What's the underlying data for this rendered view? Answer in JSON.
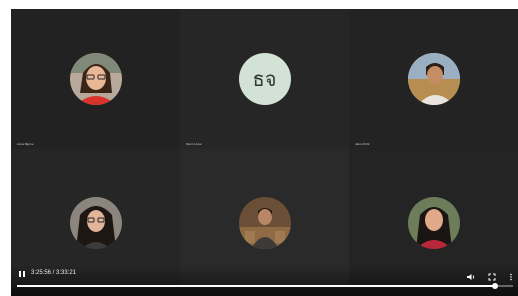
{
  "participants": [
    {
      "label": "Anna Bjorne"
    },
    {
      "label": "Simin Lhow",
      "initials": "ธจ"
    },
    {
      "label": "Jaron Pohl"
    },
    {
      "label": ""
    },
    {
      "label": ""
    },
    {
      "label": ""
    }
  ],
  "player": {
    "time": "3:25:56 / 3:33:21",
    "progress_fraction": 0.963,
    "play_icon": "pause-icon",
    "volume_icon": "volume-icon",
    "captions_icon": "fullscreen-icon",
    "more_icon": "more-vert-icon"
  },
  "colors": {
    "initials_bg": "#d2e3d6",
    "tile_bg": "#222222"
  }
}
